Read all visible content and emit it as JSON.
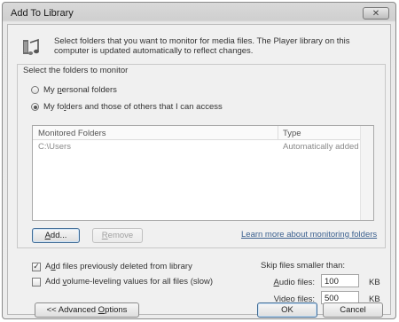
{
  "window": {
    "title": "Add To Library",
    "close_glyph": "✕"
  },
  "intro": {
    "icon": "library-music-icon",
    "text": "Select folders that you want to monitor for media files. The Player library on this computer is updated automatically to reflect changes."
  },
  "folders_group": {
    "label": "Select the folders to monitor",
    "options": [
      {
        "label": "My personal folders",
        "selected": false
      },
      {
        "label": "My folders and those of others that I can access",
        "selected": true
      }
    ]
  },
  "monitored_list": {
    "columns": [
      "Monitored Folders",
      "Type"
    ],
    "rows": [
      {
        "path": "C:\\Users",
        "type": "Automatically added"
      }
    ]
  },
  "list_actions": {
    "add_label": "Add...",
    "remove_label": "Remove",
    "learn_more_label": "Learn more about monitoring folders"
  },
  "options": {
    "add_deleted": {
      "label": "Add files previously deleted from library",
      "checked": true
    },
    "add_volume_leveling": {
      "label": "Add volume-leveling values for all files (slow)",
      "checked": false
    }
  },
  "skip": {
    "label": "Skip files smaller than:",
    "audio_label": "Audio files:",
    "audio_value": "100",
    "audio_unit": "KB",
    "video_label": "Video files:",
    "video_value": "500",
    "video_unit": "KB"
  },
  "footer": {
    "advanced_label": "<< Advanced Options",
    "ok_label": "OK",
    "cancel_label": "Cancel"
  }
}
